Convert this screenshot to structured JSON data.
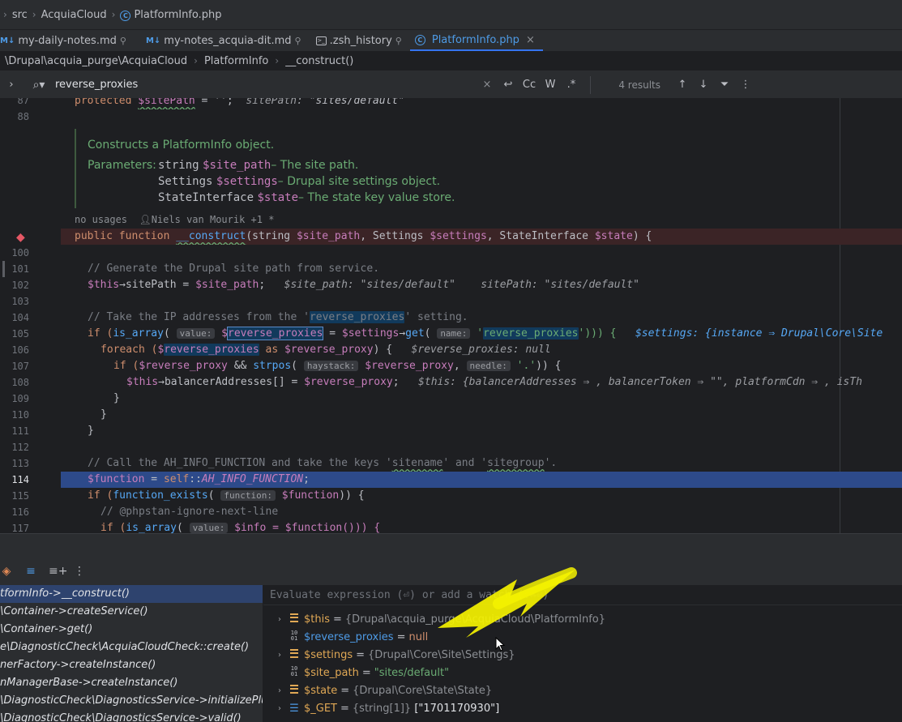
{
  "breadcrumb_top": [
    "src",
    "AcquiaCloud",
    "PlatformInfo.php"
  ],
  "tabs": [
    {
      "icon": "M↓",
      "label": "my-daily-notes.md"
    },
    {
      "icon": "M↓",
      "label": "my-notes_acquia-dit.md"
    },
    {
      "icon": "term",
      "label": ".zsh_history"
    },
    {
      "icon": "C",
      "label": "PlatformInfo.php",
      "active": true
    }
  ],
  "nav": {
    "path": "\\Drupal\\acquia_purge\\AcquiaCloud",
    "cls": "PlatformInfo",
    "method": "__construct()"
  },
  "search": {
    "query": "reverse_proxies",
    "results": "4 results",
    "opts": [
      "Cc",
      "W",
      ".*"
    ]
  },
  "doc": {
    "summary": "Constructs a PlatformInfo object.",
    "params_label": "Parameters:",
    "params": [
      {
        "type": "string",
        "name": "$site_path",
        "desc": " – The site path."
      },
      {
        "type": "Settings",
        "name": "$settings",
        "desc": " – Drupal site settings object."
      },
      {
        "type": "StateInterface",
        "name": "$state",
        "desc": " – The state key value store."
      }
    ],
    "usages": "no usages",
    "author": "Niels van Mourik +1 *"
  },
  "line_numbers": {
    "l87": "87",
    "l88": "88",
    "l100": "100",
    "l101": "101",
    "l102": "102",
    "l103": "103",
    "l104": "104",
    "l105": "105",
    "l106": "106",
    "l107": "107",
    "l108": "108",
    "l109": "109",
    "l110": "110",
    "l111": "111",
    "l112": "112",
    "l113": "113",
    "l114": "114",
    "l115": "115",
    "l116": "116",
    "l117": "117"
  },
  "code": {
    "c87a": "protected ",
    "c87b": "$sitePath",
    "c87c": " = '';  ",
    "c87d": "sitePath: ",
    "c87e": "\"sites/default\"",
    "c99a": "public function ",
    "c99b": "__construct",
    "c99c": "(string ",
    "c99d": "$site_path",
    "c99e": ", Settings ",
    "c99f": "$settings",
    "c99g": ", StateInterface ",
    "c99h": "$state",
    "c99i": ") {",
    "c101": "// Generate the Drupal site path from service.",
    "c102a": "$this",
    "c102b": "→sitePath = ",
    "c102c": "$site_path",
    "c102d": ";   ",
    "c102e": "$site_path: \"sites/default\"    sitePath: \"sites/default\"",
    "c104a": "// Take the IP addresses from the '",
    "c104b": "reverse_proxies",
    "c104c": "' setting.",
    "c105a": "if (",
    "c105b": "is_array",
    "c105c": "( ",
    "c105d": "value:",
    "c105e": " $",
    "c105f": "reverse_proxies",
    "c105g": " = ",
    "c105h": "$settings",
    "c105i": "→",
    "c105j": "get",
    "c105k": "( ",
    "c105l": "name:",
    "c105m": " '",
    "c105n": "reverse_proxies",
    "c105o": "'))) {   ",
    "c105p": "$settings: {instance ⇒ Drupal\\Core\\Site",
    "c106a": "foreach (",
    "c106b": "$",
    "c106c": "reverse_proxies",
    "c106d": " as ",
    "c106e": "$reverse_proxy",
    "c106f": ") {   ",
    "c106g": "$reverse_proxies: null",
    "c107a": "if (",
    "c107b": "$reverse_proxy",
    "c107c": " && ",
    "c107d": "strpos",
    "c107e": "( ",
    "c107f": "haystack:",
    "c107g": " $reverse_proxy",
    "c107h": ", ",
    "c107i": "needle:",
    "c107j": " '.'",
    "c107k": ")) {",
    "c108a": "$this",
    "c108b": "→balancerAddresses[] = ",
    "c108c": "$reverse_proxy",
    "c108d": ";   ",
    "c108e": "$this: {balancerAddresses ⇒ , balancerToken ⇒ \"\", platformCdn ⇒ , isTh",
    "c109": "}",
    "c110": "}",
    "c111": "}",
    "c113a": "// Call the AH_INFO_FUNCTION and take the keys '",
    "c113b": "sitename",
    "c113c": "' and '",
    "c113d": "sitegroup",
    "c113e": "'.",
    "c114a": "$function",
    "c114b": " = ",
    "c114c": "self",
    "c114d": "::",
    "c114e": "AH_INFO_FUNCTION",
    "c114f": ";",
    "c115a": "if (",
    "c115b": "function_exists",
    "c115c": "( ",
    "c115d": "function:",
    "c115e": " $function",
    "c115f": ")) {",
    "c116": "// @phpstan-ignore-next-line",
    "c117a": "if (",
    "c117b": "is_array",
    "c117c": "( ",
    "c117d": "value:",
    "c117e": " $info = $function())) {"
  },
  "frames": [
    "tformInfo->__construct()",
    "\\Container->createService()",
    "\\Container->get()",
    "e\\DiagnosticCheck\\AcquiaCloudCheck::create()",
    "nerFactory->createInstance()",
    "nManagerBase->createInstance()",
    "\\DiagnosticCheck\\DiagnosticsService->initializePlugi",
    "\\DiagnosticCheck\\DiagnosticsService->valid()"
  ],
  "eval_placeholder": "Evaluate expression (⏎) or add a watch (⇧⌘⏎)",
  "variables": [
    {
      "name": "$this",
      "type": "{Drupal\\acquia_purge\\AcquiaCloud\\PlatformInfo}",
      "value": "",
      "icon": "stack",
      "expand": true
    },
    {
      "name": "$reverse_proxies",
      "type": "",
      "value": "null",
      "icon": "bin",
      "expand": false,
      "kind": "null"
    },
    {
      "name": "$settings",
      "type": "{Drupal\\Core\\Site\\Settings}",
      "value": "",
      "icon": "stack",
      "expand": true
    },
    {
      "name": "$site_path",
      "type": "",
      "value": "\"sites/default\"",
      "icon": "bin",
      "expand": false,
      "kind": "str"
    },
    {
      "name": "$state",
      "type": "{Drupal\\Core\\State\\State}",
      "value": "",
      "icon": "stack",
      "expand": true
    },
    {
      "name": "$_GET",
      "type": "{string[1]}",
      "value": "[\"1701170930\"]",
      "icon": "list",
      "expand": true
    }
  ],
  "colors": {
    "accent": "#3574f0",
    "annotation_arrow": "#f5f200",
    "exec_line": "#2d4a8a",
    "breakpoint": "#e55765"
  }
}
